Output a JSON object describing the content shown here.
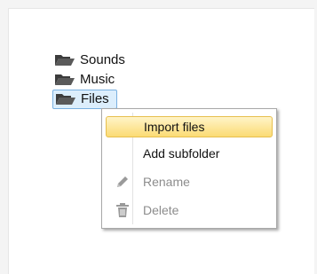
{
  "tree": {
    "items": [
      {
        "label": "Sounds",
        "icon": "folder-icon"
      },
      {
        "label": "Music",
        "icon": "folder-icon"
      },
      {
        "label": "Files",
        "icon": "folder-icon"
      }
    ]
  },
  "context_menu": {
    "items": [
      {
        "label": "Import files",
        "state": "highlighted"
      },
      {
        "label": "Add subfolder",
        "state": "enabled"
      },
      {
        "label": "Rename",
        "state": "disabled",
        "icon": "pencil-icon"
      },
      {
        "label": "Delete",
        "state": "disabled",
        "icon": "trash-icon"
      }
    ]
  },
  "colors": {
    "highlight": "#fbdb74",
    "selection": "#dceefc",
    "disabled_text": "#8c8c8c"
  }
}
